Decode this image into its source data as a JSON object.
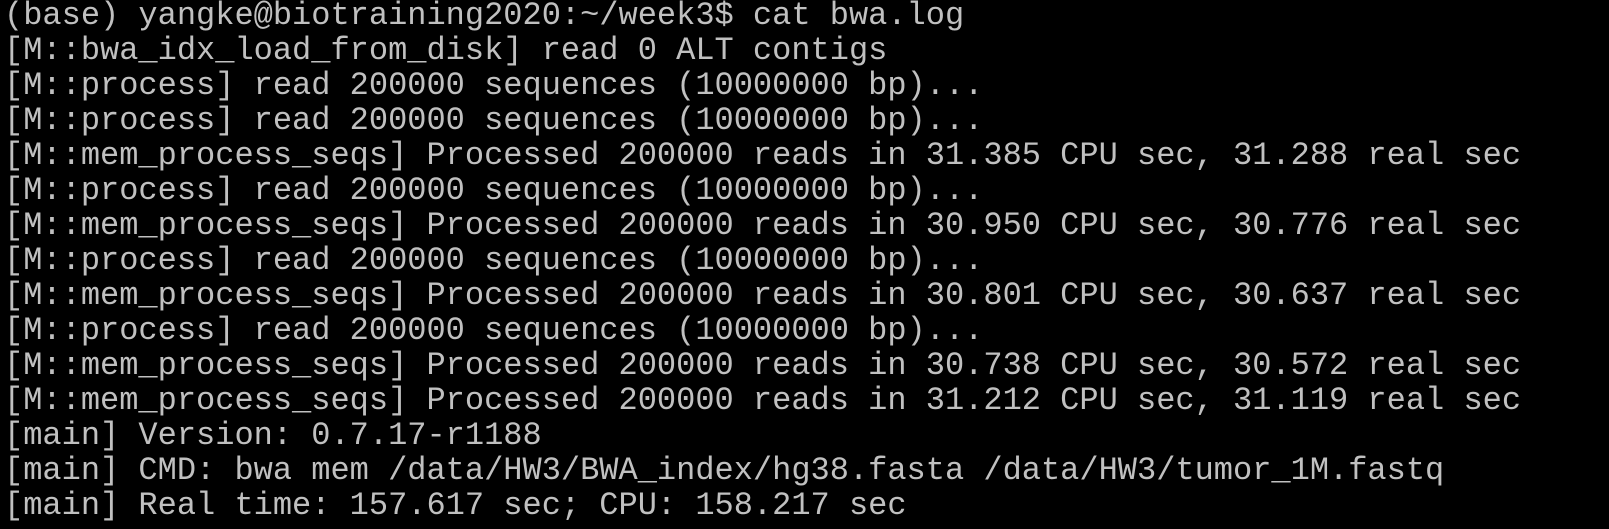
{
  "terminal": {
    "lines": [
      "(base) yangke@biotraining2020:~/week3$ cat bwa.log",
      "[M::bwa_idx_load_from_disk] read 0 ALT contigs",
      "[M::process] read 200000 sequences (10000000 bp)...",
      "[M::process] read 200000 sequences (10000000 bp)...",
      "[M::mem_process_seqs] Processed 200000 reads in 31.385 CPU sec, 31.288 real sec",
      "[M::process] read 200000 sequences (10000000 bp)...",
      "[M::mem_process_seqs] Processed 200000 reads in 30.950 CPU sec, 30.776 real sec",
      "[M::process] read 200000 sequences (10000000 bp)...",
      "[M::mem_process_seqs] Processed 200000 reads in 30.801 CPU sec, 30.637 real sec",
      "[M::process] read 200000 sequences (10000000 bp)...",
      "[M::mem_process_seqs] Processed 200000 reads in 30.738 CPU sec, 30.572 real sec",
      "[M::mem_process_seqs] Processed 200000 reads in 31.212 CPU sec, 31.119 real sec",
      "[main] Version: 0.7.17-r1188",
      "[main] CMD: bwa mem /data/HW3/BWA_index/hg38.fasta /data/HW3/tumor_1M.fastq",
      "[main] Real time: 157.617 sec; CPU: 158.217 sec"
    ],
    "colors": {
      "background": "#000000",
      "foreground": "#c0c0c0"
    }
  }
}
